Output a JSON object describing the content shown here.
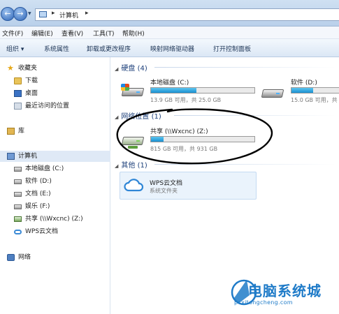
{
  "address_bar": {
    "back_glyph": "←",
    "forward_glyph": "→",
    "separator": "▸",
    "crumb": "计算机"
  },
  "menu": {
    "items": [
      "文件(F)",
      "编辑(E)",
      "查看(V)",
      "工具(T)",
      "帮助(H)"
    ]
  },
  "toolbar": {
    "organize": "组织 ▾",
    "system_properties": "系统属性",
    "uninstall_program": "卸载或更改程序",
    "map_network_drive": "映射网络驱动器",
    "open_control_panel": "打开控制面板"
  },
  "nav_pane": {
    "favorites": "收藏夹",
    "downloads": "下载",
    "desktop": "桌面",
    "recent_places": "最近访问的位置",
    "libraries": "库",
    "computer": "计算机",
    "drives": [
      "本地磁盘 (C:)",
      "软件 (D:)",
      "文档 (E:)",
      "娱乐 (F:)",
      "共享 (\\\\Wxcnc) (Z:)",
      "WPS云文档"
    ],
    "network": "网络"
  },
  "content": {
    "hard_disks_header": "硬盘 (4)",
    "network_header": "网络位置 (1)",
    "other_header": "其他 (1)",
    "drive_c": {
      "name": "本地磁盘 (C:)",
      "size": "13.9 GB 可用，共 25.0 GB",
      "used_fraction": 0.44
    },
    "drive_d": {
      "name": "软件 (D:)",
      "size": "15.0 GB 可用，共",
      "used_fraction": 0.42
    },
    "drive_z": {
      "name": "共享 (\\\\Wxcnc) (Z:)",
      "size": "815 GB 可用，共 931 GB",
      "used_fraction": 0.12
    },
    "wps": {
      "name": "WPS云文档",
      "subtitle": "系统文件夹"
    }
  },
  "watermark": {
    "title": "电脑系统城",
    "url": "pcxitongcheng.com"
  },
  "colors": {
    "accent": "#1c3f7a",
    "bar_fill": "#1a8fd1",
    "watermark": "#1f7bc8"
  }
}
